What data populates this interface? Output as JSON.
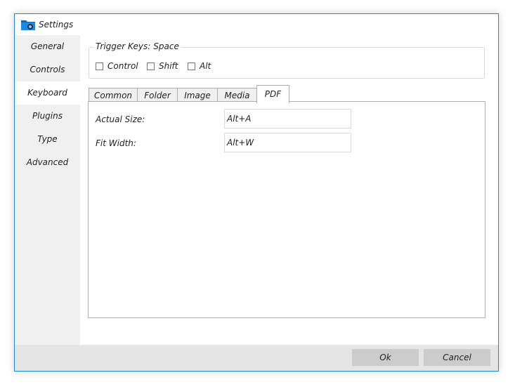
{
  "window": {
    "title": "Settings"
  },
  "sidebar": {
    "items": [
      {
        "label": "General",
        "active": false
      },
      {
        "label": "Controls",
        "active": false
      },
      {
        "label": "Keyboard",
        "active": true
      },
      {
        "label": "Plugins",
        "active": false
      },
      {
        "label": "Type",
        "active": false
      },
      {
        "label": "Advanced",
        "active": false
      }
    ]
  },
  "trigger": {
    "label": "Trigger Keys:",
    "value": "Space",
    "checkboxes": [
      {
        "label": "Control",
        "checked": false
      },
      {
        "label": "Shift",
        "checked": false
      },
      {
        "label": "Alt",
        "checked": false
      }
    ]
  },
  "tabs": [
    {
      "label": "Common",
      "active": false
    },
    {
      "label": "Folder",
      "active": false
    },
    {
      "label": "Image",
      "active": false
    },
    {
      "label": "Media",
      "active": false
    },
    {
      "label": "PDF",
      "active": true
    }
  ],
  "shortcuts": [
    {
      "label": "Actual Size:",
      "value": "Alt+A"
    },
    {
      "label": "Fit Width:",
      "value": "Alt+W"
    }
  ],
  "footer": {
    "ok_label": "Ok",
    "cancel_label": "Cancel"
  },
  "colors": {
    "window_border": "#1e88d6",
    "sidebar_bg": "#f0f0f0",
    "footer_bg": "#e5e5e5",
    "button_bg": "#cccccc"
  }
}
